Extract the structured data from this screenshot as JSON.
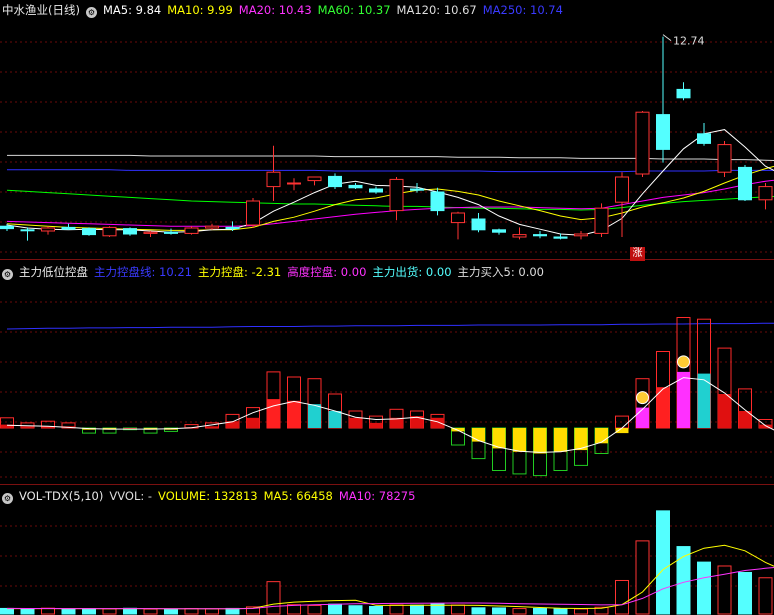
{
  "price_header": {
    "title": "中水渔业(日线)",
    "ma5": "MA5: 9.84",
    "ma10": "MA10: 9.99",
    "ma20": "MA20: 10.43",
    "ma60": "MA60: 10.37",
    "ma120": "MA120: 10.67",
    "ma250": "MA250: 10.74",
    "high_label": "12.74",
    "badge": "涨"
  },
  "indicator_header": {
    "title": "主力低位控盘",
    "line": "主力控盘线: 10.21",
    "control": "主力控盘: -2.31",
    "high": "高度控盘: 0.00",
    "out": "主力出货: 0.00",
    "buy": "主力买入5: 0.00"
  },
  "volume_header": {
    "title": "VOL-TDX(5,10)",
    "vvol": "VVOL: -",
    "volume": "VOLUME: 132813",
    "ma5": "MA5: 66458",
    "ma10": "MA10: 78275"
  },
  "colors": {
    "up": "#ff3333",
    "down": "#54ffff",
    "ma5": "#ffffff",
    "ma10": "#ffff00",
    "ma20": "#ff00ff",
    "ma60": "#00ff00",
    "ma120": "#d8d8d8",
    "ma250": "#3030ff"
  },
  "chart_data": [
    {
      "type": "candlestick",
      "title": "中水渔业(日线)",
      "candles": [
        {
          "o": 9.58,
          "h": 9.62,
          "l": 9.5,
          "c": 9.54
        },
        {
          "o": 9.52,
          "h": 9.56,
          "l": 9.34,
          "c": 9.51
        },
        {
          "o": 9.5,
          "h": 9.58,
          "l": 9.44,
          "c": 9.55
        },
        {
          "o": 9.56,
          "h": 9.62,
          "l": 9.52,
          "c": 9.53
        },
        {
          "o": 9.54,
          "h": 9.56,
          "l": 9.42,
          "c": 9.44
        },
        {
          "o": 9.42,
          "h": 9.58,
          "l": 9.4,
          "c": 9.56
        },
        {
          "o": 9.54,
          "h": 9.56,
          "l": 9.42,
          "c": 9.45
        },
        {
          "o": 9.46,
          "h": 9.5,
          "l": 9.4,
          "c": 9.48
        },
        {
          "o": 9.48,
          "h": 9.54,
          "l": 9.44,
          "c": 9.46
        },
        {
          "o": 9.46,
          "h": 9.58,
          "l": 9.44,
          "c": 9.55
        },
        {
          "o": 9.55,
          "h": 9.62,
          "l": 9.52,
          "c": 9.58
        },
        {
          "o": 9.56,
          "h": 9.66,
          "l": 9.5,
          "c": 9.54
        },
        {
          "o": 9.6,
          "h": 10.05,
          "l": 9.55,
          "c": 10.0
        },
        {
          "o": 10.24,
          "h": 10.92,
          "l": 10.0,
          "c": 10.48
        },
        {
          "o": 10.3,
          "h": 10.38,
          "l": 10.18,
          "c": 10.3
        },
        {
          "o": 10.34,
          "h": 10.4,
          "l": 10.26,
          "c": 10.4
        },
        {
          "o": 10.41,
          "h": 10.46,
          "l": 10.2,
          "c": 10.24
        },
        {
          "o": 10.26,
          "h": 10.3,
          "l": 10.2,
          "c": 10.22
        },
        {
          "o": 10.2,
          "h": 10.24,
          "l": 10.12,
          "c": 10.15
        },
        {
          "o": 9.84,
          "h": 10.4,
          "l": 9.68,
          "c": 10.36
        },
        {
          "o": 10.2,
          "h": 10.3,
          "l": 10.14,
          "c": 10.18
        },
        {
          "o": 10.15,
          "h": 10.22,
          "l": 9.76,
          "c": 9.84
        },
        {
          "o": 9.64,
          "h": 9.82,
          "l": 9.36,
          "c": 9.8
        },
        {
          "o": 9.7,
          "h": 9.8,
          "l": 9.48,
          "c": 9.52
        },
        {
          "o": 9.52,
          "h": 9.54,
          "l": 9.44,
          "c": 9.48
        },
        {
          "o": 9.4,
          "h": 9.56,
          "l": 9.36,
          "c": 9.44
        },
        {
          "o": 9.44,
          "h": 9.5,
          "l": 9.38,
          "c": 9.42
        },
        {
          "o": 9.4,
          "h": 9.46,
          "l": 9.36,
          "c": 9.38
        },
        {
          "o": 9.42,
          "h": 9.5,
          "l": 9.36,
          "c": 9.45
        },
        {
          "o": 9.46,
          "h": 9.96,
          "l": 9.4,
          "c": 9.88
        },
        {
          "o": 9.98,
          "h": 10.48,
          "l": 9.4,
          "c": 10.4
        },
        {
          "o": 10.45,
          "h": 11.5,
          "l": 10.4,
          "c": 11.48
        },
        {
          "o": 11.44,
          "h": 12.74,
          "l": 10.64,
          "c": 10.86
        },
        {
          "o": 11.86,
          "h": 11.98,
          "l": 11.68,
          "c": 11.72
        },
        {
          "o": 11.12,
          "h": 11.3,
          "l": 10.92,
          "c": 10.96
        },
        {
          "o": 10.48,
          "h": 11.0,
          "l": 10.4,
          "c": 10.94
        },
        {
          "o": 10.56,
          "h": 10.6,
          "l": 10.0,
          "c": 10.02
        },
        {
          "o": 10.02,
          "h": 10.3,
          "l": 9.86,
          "c": 10.24
        },
        {
          "o": 10.26,
          "h": 10.3,
          "l": 9.6,
          "c": 9.86
        }
      ],
      "ma5": [
        9.6,
        9.55,
        9.53,
        9.52,
        9.53,
        9.52,
        9.52,
        9.5,
        9.48,
        9.49,
        9.52,
        9.53,
        9.63,
        9.83,
        9.98,
        10.14,
        10.28,
        10.33,
        10.26,
        10.25,
        10.23,
        10.15,
        10.06,
        9.94,
        9.75,
        9.61,
        9.53,
        9.45,
        9.43,
        9.51,
        9.71,
        10.12,
        10.5,
        10.87,
        11.12,
        11.19,
        10.9,
        10.58,
        10.41
      ],
      "ma10": [
        9.62,
        9.6,
        9.58,
        9.56,
        9.55,
        9.54,
        9.53,
        9.52,
        9.51,
        9.51,
        9.52,
        9.52,
        9.56,
        9.66,
        9.73,
        9.83,
        9.94,
        10.02,
        10.05,
        10.12,
        10.18,
        10.2,
        10.16,
        10.1,
        10.0,
        9.92,
        9.84,
        9.75,
        9.69,
        9.72,
        9.8,
        9.9,
        9.97,
        10.05,
        10.16,
        10.3,
        10.43,
        10.54,
        10.63
      ],
      "ma20": [
        9.66,
        9.65,
        9.64,
        9.63,
        9.62,
        9.61,
        9.6,
        9.59,
        9.58,
        9.58,
        9.58,
        9.58,
        9.59,
        9.62,
        9.66,
        9.7,
        9.74,
        9.78,
        9.81,
        9.84,
        9.86,
        9.88,
        9.89,
        9.9,
        9.9,
        9.9,
        9.89,
        9.88,
        9.87,
        9.88,
        9.94,
        10.0,
        10.06,
        10.1,
        10.14,
        10.2,
        10.27,
        10.33,
        10.37
      ],
      "ma60": [
        10.18,
        10.16,
        10.14,
        10.12,
        10.1,
        10.08,
        10.06,
        10.04,
        10.02,
        10.0,
        9.99,
        9.98,
        9.97,
        9.96,
        9.95,
        9.95,
        9.94,
        9.93,
        9.92,
        9.91,
        9.91,
        9.9,
        9.89,
        9.88,
        9.88,
        9.87,
        9.86,
        9.86,
        9.85,
        9.86,
        9.89,
        9.93,
        9.96,
        9.99,
        10.01,
        10.03,
        10.05,
        10.07,
        10.08
      ],
      "ma120": [
        10.76,
        10.76,
        10.76,
        10.76,
        10.76,
        10.76,
        10.76,
        10.75,
        10.75,
        10.75,
        10.75,
        10.75,
        10.75,
        10.75,
        10.75,
        10.75,
        10.74,
        10.74,
        10.74,
        10.74,
        10.74,
        10.74,
        10.73,
        10.73,
        10.73,
        10.72,
        10.72,
        10.72,
        10.71,
        10.71,
        10.71,
        10.71,
        10.7,
        10.7,
        10.7,
        10.69,
        10.69,
        10.68,
        10.67
      ],
      "ma250": [
        10.52,
        10.52,
        10.52,
        10.52,
        10.52,
        10.52,
        10.51,
        10.51,
        10.51,
        10.51,
        10.51,
        10.51,
        10.51,
        10.51,
        10.51,
        10.51,
        10.5,
        10.5,
        10.5,
        10.5,
        10.5,
        10.5,
        10.5,
        10.5,
        10.49,
        10.49,
        10.49,
        10.49,
        10.49,
        10.49,
        10.49,
        10.5,
        10.5,
        10.5,
        10.5,
        10.51,
        10.51,
        10.51,
        10.51
      ],
      "high_marker": {
        "index": 32,
        "value": 12.74
      }
    },
    {
      "type": "bar",
      "title": "主力低位控盘",
      "control_line": [
        10.05,
        10.06,
        10.07,
        10.07,
        10.08,
        10.08,
        10.09,
        10.09,
        10.1,
        10.1,
        10.1,
        10.11,
        10.12,
        10.12,
        10.12,
        10.13,
        10.13,
        10.14,
        10.14,
        10.14,
        10.15,
        10.15,
        10.15,
        10.16,
        10.16,
        10.16,
        10.16,
        10.17,
        10.17,
        10.17,
        10.18,
        10.18,
        10.19,
        10.19,
        10.2,
        10.2,
        10.2,
        10.21,
        10.21
      ],
      "hist": [
        0.2,
        0.1,
        0.1,
        0.1,
        -0.1,
        -0.1,
        0,
        -0.1,
        -0.1,
        0.05,
        0.1,
        0.4,
        0.6,
        1.7,
        1.6,
        1.4,
        1.0,
        0.6,
        0.3,
        0.6,
        0.7,
        0.6,
        -0.2,
        -0.8,
        -1.2,
        -1.4,
        -1.5,
        -1.4,
        -1.3,
        -0.9,
        -0.3,
        1.2,
        2.4,
        3.3,
        3.2,
        2.0,
        1.0,
        0.2,
        -0.8
      ],
      "envelope": [
        0.6,
        0.3,
        0.4,
        0.3,
        -0.3,
        -0.3,
        -0.1,
        -0.3,
        -0.2,
        0.2,
        0.3,
        0.8,
        1.2,
        3.3,
        3.0,
        2.9,
        2.0,
        1.0,
        0.7,
        1.1,
        1.0,
        0.8,
        -1.0,
        -1.8,
        -2.5,
        -2.7,
        -2.8,
        -2.5,
        -2.2,
        -1.5,
        0.7,
        2.9,
        4.5,
        6.5,
        6.4,
        4.7,
        2.3,
        0.5,
        -2.3
      ],
      "money_icons": [
        31,
        33
      ]
    },
    {
      "type": "bar",
      "title": "VOL-TDX(5,10)",
      "volume": [
        4300,
        3900,
        4500,
        3900,
        4200,
        4000,
        4400,
        3800,
        3900,
        4200,
        4000,
        4300,
        5500,
        25000,
        7200,
        6600,
        7600,
        6400,
        5800,
        7000,
        6800,
        7800,
        6900,
        4800,
        4700,
        4200,
        4300,
        4000,
        3900,
        5200,
        25900,
        56500,
        79700,
        52100,
        40100,
        37100,
        32100,
        28000,
        26700
      ],
      "ma5": [
        4200,
        4150,
        4200,
        4160,
        4160,
        4100,
        4200,
        4160,
        4060,
        4060,
        4060,
        4100,
        4380,
        7660,
        9200,
        9840,
        10380,
        10560,
        6720,
        6680,
        6720,
        6720,
        6780,
        6660,
        6200,
        5680,
        5000,
        4400,
        4280,
        4400,
        7260,
        17000,
        34300,
        44460,
        50860,
        53100,
        48840,
        39900,
        32800
      ],
      "ma10": [
        4300,
        4250,
        4230,
        4200,
        4200,
        4150,
        4160,
        4150,
        4120,
        4110,
        4110,
        4120,
        4260,
        5900,
        6640,
        7130,
        7570,
        7860,
        8020,
        8160,
        8300,
        8440,
        8510,
        8480,
        8240,
        7970,
        7720,
        7510,
        7370,
        7020,
        7130,
        12050,
        19490,
        24530,
        28080,
        30690,
        33620,
        35340,
        36700
      ]
    }
  ]
}
